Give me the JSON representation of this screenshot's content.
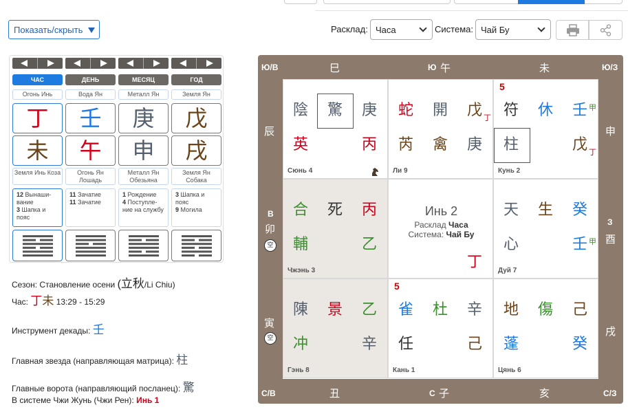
{
  "toolbar": {
    "show_hide": "Показать/скрыть",
    "layout_label": "Расклад:",
    "layout_value": "Часа",
    "system_label": "Система:",
    "system_value": "Чай Бу"
  },
  "pillars": [
    {
      "header": "ЧАС",
      "element": "Огонь Инь",
      "stem": "丁",
      "stem_color": "#d0021b",
      "branch": "未",
      "branch_color": "#6b4419",
      "animal": "Земля Инь Коза",
      "s1n": "12",
      "s1": "Вынаши-вание",
      "s2n": "3",
      "s2": "Шапка и пояс"
    },
    {
      "header": "ДЕНЬ",
      "element": "Вода Ян",
      "stem": "壬",
      "stem_color": "#1f7ae0",
      "branch": "午",
      "branch_color": "#d0021b",
      "animal": "Огонь Ян Лошадь",
      "s1n": "11",
      "s1": "Зачатие",
      "s2n": "11",
      "s2": "Зачатие"
    },
    {
      "header": "МЕСЯЦ",
      "element": "Металл Ян",
      "stem": "庚",
      "stem_color": "#55606e",
      "branch": "申",
      "branch_color": "#55606e",
      "animal": "Металл Ян Обезьяна",
      "s1n": "1",
      "s1": "Рождение",
      "s2n": "4",
      "s2": "Поступле-ние на службу"
    },
    {
      "header": "ГОД",
      "element": "Земля Ян",
      "stem": "戊",
      "stem_color": "#6b4419",
      "branch": "戌",
      "branch_color": "#6b4419",
      "animal": "Земля Ян Собака",
      "s1n": "3",
      "s1": "Шапка и пояс",
      "s2n": "9",
      "s2": "Могила"
    }
  ],
  "info": {
    "season_label": "Сезон:",
    "season_value": "Становление осени",
    "season_cn": "立秋",
    "season_tr": "/Li Chiu)",
    "hour_label": "Час:",
    "hour_cn1": "丁",
    "hour_cn2": "未",
    "hour_time": "13:29 - 15:29",
    "decade_label": "Инструмент декады:",
    "decade_cn": "壬",
    "star_label": "Главная звезда (направляющая матрица):",
    "star_cn": "柱",
    "gate_label": "Главные ворота (направляющий посланец):",
    "gate_cn": "驚",
    "zhi_label": "В системе Чжи Жунь (Чжи Рен):",
    "zhi_value": "Инь 1"
  },
  "board": {
    "corners": {
      "tl": "Ю/В",
      "tr": "Ю/З",
      "bl": "С/В",
      "br": "С/З"
    },
    "top": {
      "left_cn": "巳",
      "mid_label": "Ю",
      "mid_cn": "午",
      "right_cn": "未"
    },
    "bottom": {
      "left_cn": "丑",
      "mid_label": "С",
      "mid_cn": "子",
      "right_cn": "亥"
    },
    "left": {
      "top_cn": "辰",
      "mid_label": "В",
      "mid_cn": "卯",
      "bot_cn": "寅",
      "empty": "空"
    },
    "right": {
      "top_cn": "申",
      "mid_label": "З",
      "mid_cn": "酉",
      "bot_cn": "戌"
    },
    "center": {
      "title": "Инь 2",
      "line1_pre": "Расклад",
      "line1_val": "Часа",
      "line2_pre": "Система:",
      "line2_val": "Чай Бу",
      "glyph": "丁"
    },
    "cells": {
      "c4": {
        "name": "Сюнь 4",
        "g1": "陰",
        "g2": "驚",
        "g3": "庚",
        "g4": "英",
        "g5": "丙"
      },
      "c9": {
        "name": "Ли 9",
        "g1": "蛇",
        "g2": "開",
        "g3": "戊",
        "g3s": "丁",
        "g4": "芮",
        "g5": "禽",
        "g6": "庚"
      },
      "c2": {
        "name": "Кунь 2",
        "num": "5",
        "g1": "符",
        "g2": "休",
        "g3": "壬",
        "g3s": "甲",
        "g4": "柱",
        "g5": "戊",
        "g5s": "丁"
      },
      "c3": {
        "name": "Чжэнь 3",
        "g1": "合",
        "g2": "死",
        "g3": "丙",
        "g4": "輔",
        "g5": "乙"
      },
      "c7": {
        "name": "Дуй 7",
        "g1": "天",
        "g2": "生",
        "g3": "癸",
        "g4": "心",
        "g5": "壬",
        "g5s": "甲"
      },
      "c8": {
        "name": "Гэнь 8",
        "g1": "陳",
        "g2": "景",
        "g3": "乙",
        "g4": "冲",
        "g5": "辛"
      },
      "c1": {
        "name": "Кань 1",
        "num": "5",
        "g1": "雀",
        "g2": "杜",
        "g3": "辛",
        "g4": "任",
        "g5": "己"
      },
      "c6": {
        "name": "Цянь 6",
        "g1": "地",
        "g2": "傷",
        "g3": "己",
        "g4": "蓬",
        "g5": "癸"
      }
    }
  }
}
